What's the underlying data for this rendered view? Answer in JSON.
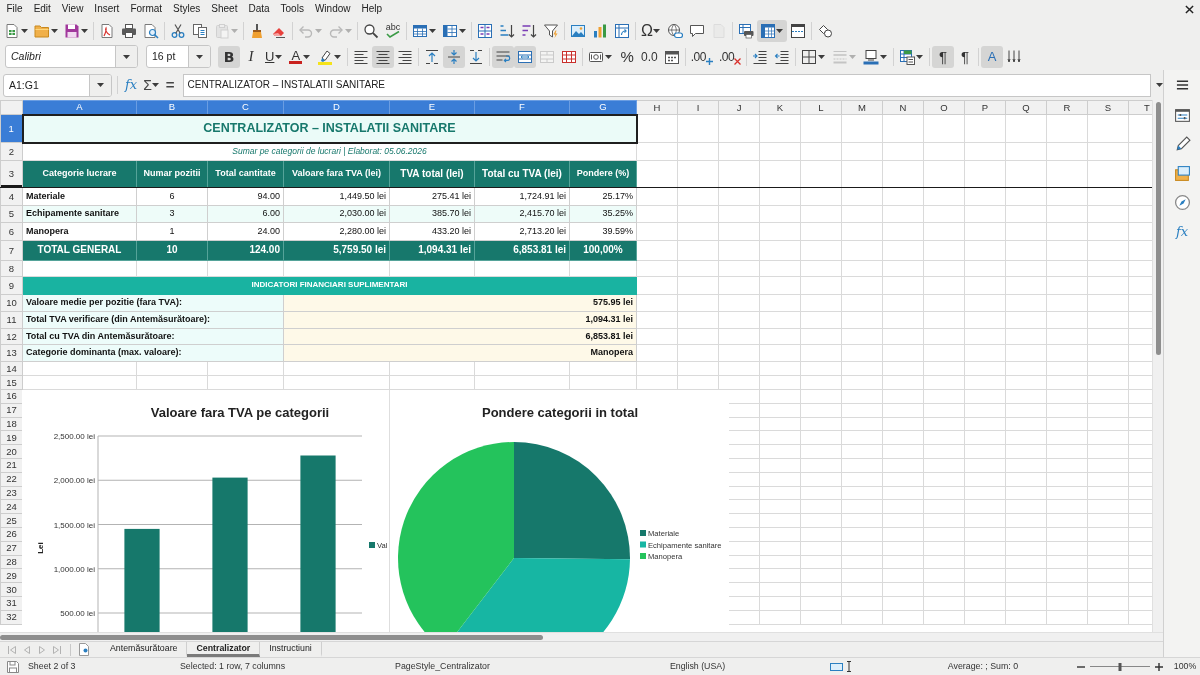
{
  "menu_bar": [
    "File",
    "Edit",
    "View",
    "Insert",
    "Format",
    "Styles",
    "Sheet",
    "Data",
    "Tools",
    "Window",
    "Help"
  ],
  "standard_toolbar": [
    {
      "buttons": [
        {
          "kind": "new",
          "pressed": false,
          "disabled": false
        },
        {
          "kind": "open",
          "pressed": false,
          "disabled": false
        },
        {
          "kind": "save",
          "pressed": false,
          "disabled": false
        }
      ]
    },
    {
      "buttons": [
        {
          "kind": "export_pdf",
          "pressed": false,
          "disabled": false
        },
        {
          "kind": "print",
          "pressed": false,
          "disabled": false
        },
        {
          "kind": "print_preview",
          "pressed": false,
          "disabled": false
        }
      ]
    },
    {
      "buttons": [
        {
          "kind": "cut",
          "pressed": false,
          "disabled": false
        },
        {
          "kind": "copy",
          "pressed": false,
          "disabled": false
        },
        {
          "kind": "paste",
          "pressed": false,
          "disabled": true
        }
      ]
    },
    {
      "buttons": [
        {
          "kind": "clone_formatting",
          "pressed": false,
          "disabled": false
        },
        {
          "kind": "clear_formatting",
          "pressed": false,
          "disabled": false
        }
      ]
    },
    {
      "buttons": [
        {
          "kind": "undo",
          "pressed": false,
          "disabled": true
        },
        {
          "kind": "redo",
          "pressed": false,
          "disabled": true
        }
      ]
    },
    {
      "buttons": [
        {
          "kind": "find_replace",
          "pressed": false,
          "disabled": false
        },
        {
          "kind": "spelling",
          "label": "abc",
          "pressed": false,
          "disabled": false
        }
      ]
    },
    {
      "buttons": [
        {
          "kind": "row",
          "pressed": false,
          "disabled": false
        },
        {
          "kind": "column",
          "pressed": false,
          "disabled": false
        }
      ]
    },
    {
      "buttons": [
        {
          "kind": "sort",
          "pressed": false,
          "disabled": false
        },
        {
          "kind": "sort_ascending",
          "pressed": false,
          "disabled": false
        },
        {
          "kind": "sort_descending",
          "pressed": false,
          "disabled": false
        },
        {
          "kind": "autofilter",
          "pressed": false,
          "disabled": false
        }
      ]
    },
    {
      "buttons": [
        {
          "kind": "image",
          "pressed": false,
          "disabled": false
        },
        {
          "kind": "chart",
          "pressed": false,
          "disabled": false
        },
        {
          "kind": "pivot_table",
          "pressed": false,
          "disabled": false
        }
      ]
    },
    {
      "buttons": [
        {
          "kind": "special_character",
          "label": "Ω",
          "pressed": false,
          "disabled": false
        },
        {
          "kind": "hyperlink",
          "pressed": false,
          "disabled": false
        },
        {
          "kind": "comment",
          "pressed": false,
          "disabled": false
        },
        {
          "kind": "headers_footers",
          "pressed": false,
          "disabled": true
        }
      ]
    },
    {
      "buttons": [
        {
          "kind": "print_area",
          "pressed": false,
          "disabled": false
        },
        {
          "kind": "freeze",
          "pressed": true,
          "disabled": false
        },
        {
          "kind": "split_window",
          "pressed": false,
          "disabled": false
        }
      ]
    },
    {
      "buttons": [
        {
          "kind": "draw_functions",
          "pressed": false,
          "disabled": false
        }
      ]
    }
  ],
  "formatting_toolbar": {
    "font_name": "Calibri",
    "font_size": "16 pt",
    "groups": [
      {
        "buttons": [
          {
            "kind": "bold",
            "label": "B",
            "pressed": true,
            "disabled": false
          },
          {
            "kind": "italic",
            "label": "I",
            "pressed": false,
            "disabled": false
          },
          {
            "kind": "underline",
            "label": "U",
            "pressed": false,
            "disabled": false
          },
          {
            "kind": "font_color",
            "label": "A",
            "pressed": false,
            "disabled": false
          },
          {
            "kind": "highlighting",
            "pressed": false,
            "disabled": false
          }
        ]
      },
      {
        "buttons": [
          {
            "kind": "align_left",
            "pressed": false,
            "disabled": false
          },
          {
            "kind": "align_center",
            "pressed": true,
            "disabled": false
          },
          {
            "kind": "align_right",
            "pressed": false,
            "disabled": false
          }
        ]
      },
      {
        "buttons": [
          {
            "kind": "align_top",
            "pressed": false,
            "disabled": false
          },
          {
            "kind": "align_middle",
            "pressed": true,
            "disabled": false
          },
          {
            "kind": "align_bottom",
            "pressed": false,
            "disabled": false
          }
        ]
      },
      {
        "buttons": [
          {
            "kind": "wrap_text",
            "pressed": true,
            "disabled": false
          },
          {
            "kind": "merge_center",
            "pressed": true,
            "disabled": false
          },
          {
            "kind": "merge_cells",
            "pressed": false,
            "disabled": true
          },
          {
            "kind": "unmerge_cells",
            "pressed": false,
            "disabled": false
          }
        ]
      },
      {
        "buttons": [
          {
            "kind": "currency",
            "pressed": false,
            "disabled": false
          },
          {
            "kind": "percent",
            "label": "%",
            "pressed": false,
            "disabled": false
          },
          {
            "kind": "number",
            "label": "0.0",
            "pressed": false,
            "disabled": false
          },
          {
            "kind": "date",
            "pressed": false,
            "disabled": false
          }
        ]
      },
      {
        "buttons": [
          {
            "kind": "add_decimal",
            "label": ".00",
            "pressed": false,
            "disabled": false
          },
          {
            "kind": "delete_decimal",
            "label": ".00",
            "pressed": false,
            "disabled": false
          }
        ]
      },
      {
        "buttons": [
          {
            "kind": "increase_indent",
            "pressed": false,
            "disabled": false
          },
          {
            "kind": "decrease_indent",
            "pressed": false,
            "disabled": false
          }
        ]
      },
      {
        "buttons": [
          {
            "kind": "borders",
            "pressed": false,
            "disabled": false
          },
          {
            "kind": "border_style",
            "pressed": false,
            "disabled": true
          },
          {
            "kind": "border_color",
            "pressed": false,
            "disabled": false
          }
        ]
      },
      {
        "buttons": [
          {
            "kind": "conditional",
            "pressed": false,
            "disabled": false
          }
        ]
      },
      {
        "buttons": [
          {
            "kind": "left_to_right",
            "label": "¶",
            "pressed": true,
            "disabled": false
          },
          {
            "kind": "right_to_left",
            "label": "¶",
            "pressed": false,
            "disabled": false
          }
        ]
      },
      {
        "buttons": [
          {
            "kind": "text_left_to_right",
            "label": "A",
            "pressed": true,
            "disabled": false
          },
          {
            "kind": "text_top_to_bottom",
            "pressed": false,
            "disabled": false
          }
        ]
      }
    ]
  },
  "formula_bar": {
    "name_box": "A1:G1",
    "function_wizard": "fx",
    "sum": "Σ",
    "equals": "=",
    "content": "CENTRALIZATOR – INSTALATII SANITARE"
  },
  "sheet": {
    "columns": [
      {
        "label": "A",
        "selected": true
      },
      {
        "label": "B",
        "selected": true
      },
      {
        "label": "C",
        "selected": true
      },
      {
        "label": "D",
        "selected": true
      },
      {
        "label": "E",
        "selected": true
      },
      {
        "label": "F",
        "selected": true
      },
      {
        "label": "G",
        "selected": true
      },
      {
        "label": "H",
        "selected": false
      },
      {
        "label": "I",
        "selected": false
      },
      {
        "label": "J",
        "selected": false
      },
      {
        "label": "K",
        "selected": false
      },
      {
        "label": "L",
        "selected": false
      },
      {
        "label": "M",
        "selected": false
      },
      {
        "label": "N",
        "selected": false
      },
      {
        "label": "O",
        "selected": false
      },
      {
        "label": "P",
        "selected": false
      },
      {
        "label": "Q",
        "selected": false
      },
      {
        "label": "R",
        "selected": false
      },
      {
        "label": "S",
        "selected": false
      },
      {
        "label": "T",
        "selected": false
      }
    ],
    "rows": [
      {
        "label": "1",
        "selected": true,
        "freeze_below": false
      },
      {
        "label": "2",
        "selected": false,
        "freeze_below": false
      },
      {
        "label": "3",
        "selected": false,
        "freeze_below": true
      },
      {
        "label": "4",
        "selected": false,
        "freeze_below": false
      },
      {
        "label": "5",
        "selected": false,
        "freeze_below": false
      },
      {
        "label": "6",
        "selected": false,
        "freeze_below": false
      },
      {
        "label": "7",
        "selected": false,
        "freeze_below": false
      },
      {
        "label": "8",
        "selected": false,
        "freeze_below": false
      },
      {
        "label": "9",
        "selected": false,
        "freeze_below": false
      },
      {
        "label": "10",
        "selected": false,
        "freeze_below": false
      },
      {
        "label": "11",
        "selected": false,
        "freeze_below": false
      },
      {
        "label": "12",
        "selected": false,
        "freeze_below": false
      },
      {
        "label": "13",
        "selected": false,
        "freeze_below": false
      },
      {
        "label": "14",
        "selected": false,
        "freeze_below": false
      },
      {
        "label": "15",
        "selected": false,
        "freeze_below": false
      },
      {
        "label": "16",
        "selected": false,
        "freeze_below": false
      },
      {
        "label": "17",
        "selected": false,
        "freeze_below": false
      },
      {
        "label": "18",
        "selected": false,
        "freeze_below": false
      },
      {
        "label": "19",
        "selected": false,
        "freeze_below": false
      },
      {
        "label": "20",
        "selected": false,
        "freeze_below": false
      },
      {
        "label": "21",
        "selected": false,
        "freeze_below": false
      },
      {
        "label": "22",
        "selected": false,
        "freeze_below": false
      },
      {
        "label": "23",
        "selected": false,
        "freeze_below": false
      },
      {
        "label": "24",
        "selected": false,
        "freeze_below": false
      },
      {
        "label": "25",
        "selected": false,
        "freeze_below": false
      },
      {
        "label": "26",
        "selected": false,
        "freeze_below": false
      },
      {
        "label": "27",
        "selected": false,
        "freeze_below": false
      },
      {
        "label": "28",
        "selected": false,
        "freeze_below": false
      },
      {
        "label": "29",
        "selected": false,
        "freeze_below": false
      },
      {
        "label": "30",
        "selected": false,
        "freeze_below": false
      },
      {
        "label": "31",
        "selected": false,
        "freeze_below": false
      },
      {
        "label": "32",
        "selected": false,
        "freeze_below": false
      }
    ],
    "title": {
      "text": "CENTRALIZATOR – INSTALATII SANITARE",
      "selected": true
    },
    "subtitle": "Sumar pe categorii de lucrari | Elaborat: 05.06.2026",
    "header": [
      "Categorie lucrare",
      "Numar pozitii",
      "Total cantitate",
      "Valoare fara TVA (lei)",
      "TVA total (lei)",
      "Total cu TVA (lei)",
      "Pondere (%)"
    ],
    "data_rows": [
      [
        "Materiale",
        "6",
        "94.00",
        "1,449.50 lei",
        "275.41 lei",
        "1,724.91 lei",
        "25.17%"
      ],
      [
        "Echipamente sanitare",
        "3",
        "6.00",
        "2,030.00 lei",
        "385.70 lei",
        "2,415.70 lei",
        "35.25%"
      ],
      [
        "Manopera",
        "1",
        "24.00",
        "2,280.00 lei",
        "433.20 lei",
        "2,713.20 lei",
        "39.59%"
      ]
    ],
    "total_row": [
      "TOTAL GENERAL",
      "10",
      "124.00",
      "5,759.50 lei",
      "1,094.31 lei",
      "6,853.81 lei",
      "100,00%"
    ],
    "section_title": "INDICATORI FINANCIARI SUPLIMENTARI",
    "indicators": [
      {
        "label": "Valoare medie per pozitie (fara TVA):",
        "value": "575.95 lei"
      },
      {
        "label": "Total TVA verificare (din Antemăsurătoare):",
        "value": "1,094.31 lei"
      },
      {
        "label": "Total cu TVA din Antemăsurătoare:",
        "value": "6,853.81 lei"
      },
      {
        "label": "Categorie dominanta (max. valoare):",
        "value": "Manopera"
      }
    ],
    "charts": [
      {
        "chart_data": {
          "type": "bar",
          "title": "Valoare fara TVA pe categorii",
          "ylabel": "Lei",
          "series": [
            {
              "name": "Val",
              "color": "#16786b",
              "values": [
                1450,
                2030,
                2280
              ]
            }
          ],
          "ylim": [
            0,
            2500
          ],
          "yticks": [
            {
              "value": 500,
              "label": "500.00 lei"
            },
            {
              "value": 1000,
              "label": "1,000.00 lei"
            },
            {
              "value": 1500,
              "label": "1,500.00 lei"
            },
            {
              "value": 2000,
              "label": "2,000.00 lei"
            },
            {
              "value": 2500,
              "label": "2,500.00 lei"
            }
          ],
          "grid": true,
          "legend": "right"
        }
      },
      {
        "chart_data": {
          "type": "pie",
          "title": "Pondere categorii in total",
          "categories": [
            "Materiale",
            "Echipamente sanitare",
            "Manopera"
          ],
          "values": [
            25.17,
            35.25,
            39.59
          ],
          "colors": [
            "#16786b",
            "#17b6a3",
            "#24c35c"
          ],
          "legend": "right"
        }
      }
    ]
  },
  "sheet_navigation": [
    {
      "kind": "first",
      "disabled": true
    },
    {
      "kind": "previous",
      "disabled": true
    },
    {
      "kind": "next",
      "disabled": true
    },
    {
      "kind": "last",
      "disabled": true
    }
  ],
  "sheet_tabs": [
    {
      "label": "Antemăsurătoare",
      "selected": false
    },
    {
      "label": "Centralizator",
      "selected": true
    },
    {
      "label": "Instructiuni",
      "selected": false
    }
  ],
  "sidebar": [
    {
      "kind": "properties"
    },
    {
      "kind": "styles"
    },
    {
      "kind": "gallery"
    },
    {
      "kind": "navigator"
    },
    {
      "kind": "functions",
      "label": "fx"
    }
  ],
  "status_bar": {
    "sheet": "Sheet 2 of 3",
    "selection": "Selected: 1 row, 7 columns",
    "page_style": "PageStyle_Centralizator",
    "language": "English (USA)",
    "summary": "Average: ; Sum: 0",
    "zoom": {
      "level": 0.5,
      "reading": "100%"
    }
  }
}
